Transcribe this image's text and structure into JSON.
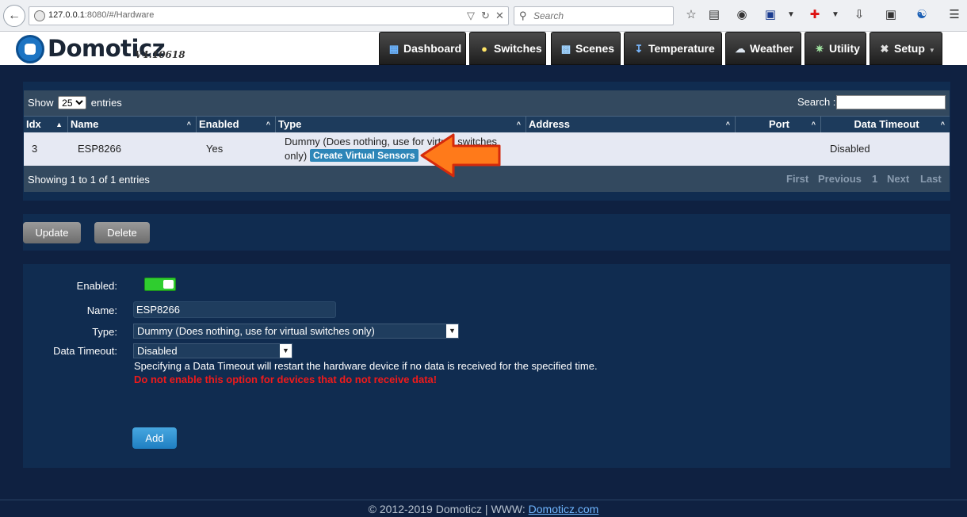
{
  "browser": {
    "url_host": "127.0.0.1",
    "url_rest": ":8080/#/Hardware",
    "search_placeholder": "Search"
  },
  "app": {
    "logo": "Domoticz",
    "version": "V4.10618",
    "nav": [
      {
        "label": "Dashboard",
        "icon": "dashboard-icon"
      },
      {
        "label": "Switches",
        "icon": "lightbulb-icon"
      },
      {
        "label": "Scenes",
        "icon": "scenes-icon"
      },
      {
        "label": "Temperature",
        "icon": "thermometer-icon"
      },
      {
        "label": "Weather",
        "icon": "weather-icon"
      },
      {
        "label": "Utility",
        "icon": "utility-icon"
      },
      {
        "label": "Setup",
        "icon": "tools-icon"
      }
    ]
  },
  "table": {
    "show_label": "Show",
    "entries_value": "25",
    "entries_label": "entries",
    "search_label": "Search :",
    "columns": [
      "Idx",
      "Name",
      "Enabled",
      "Type",
      "Address",
      "Port",
      "Data Timeout"
    ],
    "rows": [
      {
        "idx": "3",
        "name": "ESP8266",
        "enabled": "Yes",
        "type_line1": "Dummy (Does nothing, use for virtual switches",
        "type_line2": "only)",
        "type_button": "Create Virtual Sensors",
        "address": "",
        "port": "",
        "data_timeout": "Disabled"
      }
    ],
    "info": "Showing 1 to 1 of 1 entries",
    "pager": {
      "first": "First",
      "previous": "Previous",
      "page": "1",
      "next": "Next",
      "last": "Last"
    }
  },
  "actions": {
    "update": "Update",
    "delete": "Delete"
  },
  "form": {
    "enabled_label": "Enabled:",
    "name_label": "Name:",
    "name_value": "ESP8266",
    "type_label": "Type:",
    "type_value": "Dummy (Does nothing, use for virtual switches only)",
    "timeout_label": "Data Timeout:",
    "timeout_value": "Disabled",
    "hint": "Specifying a Data Timeout will restart the hardware device if no data is received for the specified time.",
    "warning": "Do not enable this option for devices that do not receive data!",
    "add": "Add"
  },
  "footer": {
    "text": "© 2012-2019 Domoticz | WWW: ",
    "link": "Domoticz.com"
  },
  "colors": {
    "background": "#0f2141",
    "accent": "#2e86b8",
    "warning": "#f01a1a",
    "toggle_on": "#2fcd2f",
    "arrow": "#ff7a1a"
  }
}
